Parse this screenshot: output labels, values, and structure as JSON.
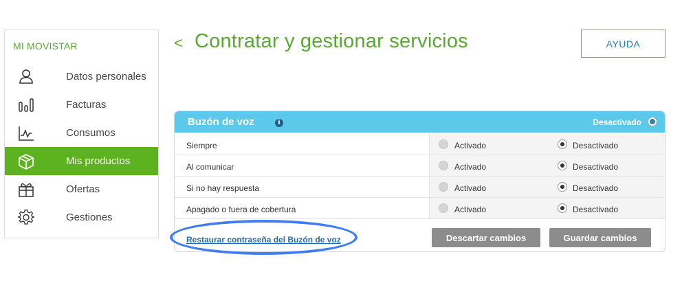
{
  "sidebar": {
    "title": "MI MOVISTAR",
    "items": [
      {
        "label": "Datos personales",
        "icon": "user-icon",
        "active": false
      },
      {
        "label": "Facturas",
        "icon": "bar-chart-icon",
        "active": false
      },
      {
        "label": "Consumos",
        "icon": "line-chart-icon",
        "active": false
      },
      {
        "label": "Mis productos",
        "icon": "package-icon",
        "active": true
      },
      {
        "label": "Ofertas",
        "icon": "gift-icon",
        "active": false
      },
      {
        "label": "Gestiones",
        "icon": "gear-icon",
        "active": false
      }
    ]
  },
  "header": {
    "back_glyph": "<",
    "title": "Contratar y gestionar servicios",
    "help_label": "AYUDA"
  },
  "panel": {
    "title": "Buzón de voz",
    "info_glyph": "i",
    "status": "Desactivado",
    "rows": [
      {
        "label": "Siempre",
        "option_on": "Activado",
        "option_off": "Desactivado",
        "selected": "Desactivado"
      },
      {
        "label": "Al comunicar",
        "option_on": "Activado",
        "option_off": "Desactivado",
        "selected": "Desactivado"
      },
      {
        "label": "Si no hay respuesta",
        "option_on": "Activado",
        "option_off": "Desactivado",
        "selected": "Desactivado"
      },
      {
        "label": "Apagado o fuera de cobertura",
        "option_on": "Activado",
        "option_off": "Desactivado",
        "selected": "Desactivado"
      }
    ],
    "reset_link": "Restaurar contraseña del Buzón de voz",
    "discard_label": "Descartar cambios",
    "save_label": "Guardar cambios"
  },
  "colors": {
    "brand_green": "#5cb21f",
    "panel_header": "#5dc9ea",
    "link_blue": "#1a6fb3",
    "highlight": "#3f7df0"
  }
}
